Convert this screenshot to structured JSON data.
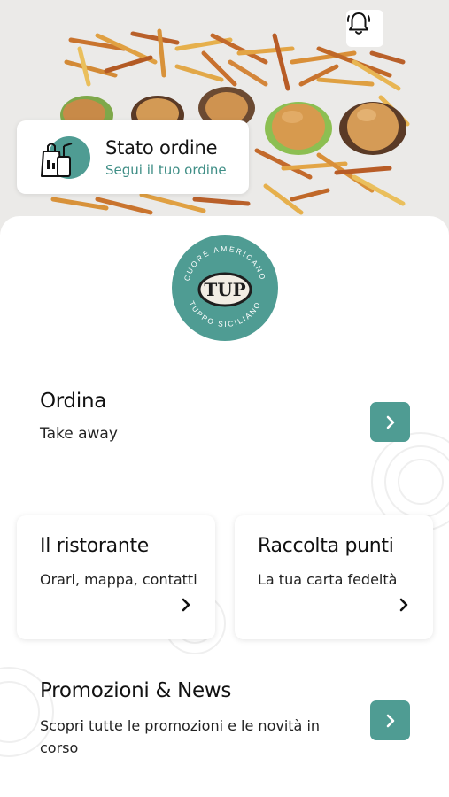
{
  "hero": {
    "image_alt": "burgers-and-fries-photo",
    "notification_icon": "bell-icon"
  },
  "order_status": {
    "icon": "takeaway-bag-icon",
    "title": "Stato ordine",
    "subtitle": "Segui il tuo ordine"
  },
  "logo": {
    "top_text": "CUORE AMERICANO",
    "bottom_text": "TUPPO SICILIANO",
    "brand": "TUP"
  },
  "ordina": {
    "title": "Ordina",
    "subtitle": "Take away",
    "icon": "chevron-right-icon"
  },
  "tiles": [
    {
      "title": "Il ristorante",
      "subtitle": "Orari, mappa, contatti",
      "icon": "chevron-right-icon"
    },
    {
      "title": "Raccolta punti",
      "subtitle": "La tua carta fedeltà",
      "icon": "chevron-right-icon"
    }
  ],
  "promo": {
    "title": "Promozioni & News",
    "subtitle": "Scopri tutte le promozioni e le novità in corso",
    "icon": "chevron-right-icon"
  },
  "colors": {
    "accent": "#4f9c93",
    "accent_text": "#3f8e86",
    "hero_bg": "#ebeae8"
  }
}
